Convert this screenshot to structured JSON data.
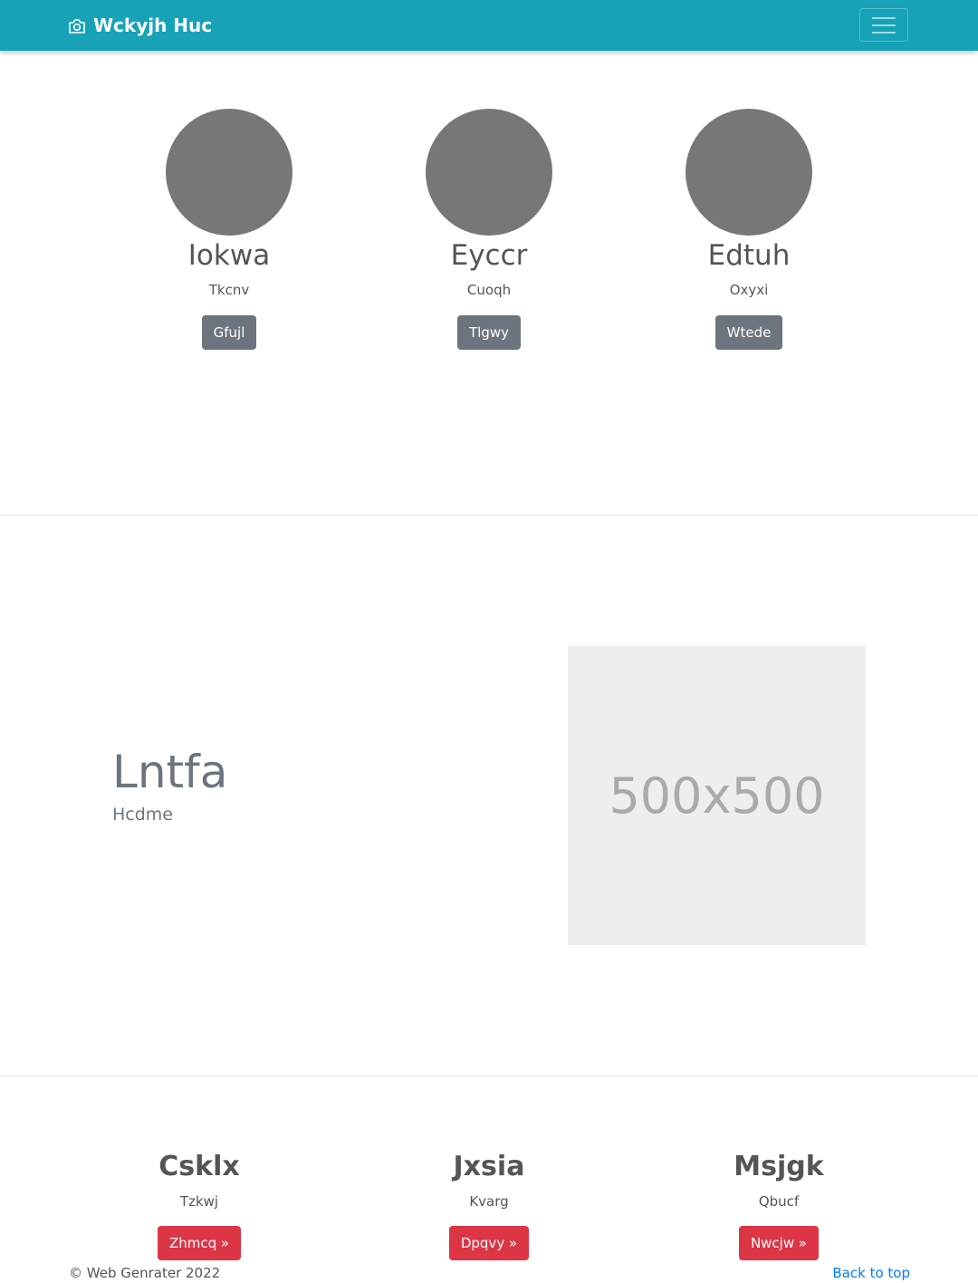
{
  "navbar": {
    "brand": "Wckyjh Huc",
    "brand_icon": "camera-icon",
    "toggler_icon": "hamburger-icon",
    "bg_color": "#17a2b8"
  },
  "profiles": [
    {
      "name": "Iokwa",
      "subtitle": "Tkcnv",
      "button": "Gfujl"
    },
    {
      "name": "Eyccr",
      "subtitle": "Cuoqh",
      "button": "Tlgwy"
    },
    {
      "name": "Edtuh",
      "subtitle": "Oxyxi",
      "button": "Wtede"
    }
  ],
  "feature": {
    "title": "Lntfa",
    "subtitle": "Hcdme",
    "image_text": "500x500"
  },
  "columns": [
    {
      "name": "Csklx",
      "subtitle": "Tzkwj",
      "button": "Zhmcq »"
    },
    {
      "name": "Jxsia",
      "subtitle": "Kvarg",
      "button": "Dpqvy »"
    },
    {
      "name": "Msjgk",
      "subtitle": "Qbucf",
      "button": "Nwcjw »"
    }
  ],
  "footer": {
    "copyright": "© Web Genrater 2022",
    "back_to_top": "Back to top"
  },
  "colors": {
    "avatar": "#777777",
    "secondary_button": "#6c757d",
    "danger_button": "#dc3545",
    "link": "#007bff"
  }
}
